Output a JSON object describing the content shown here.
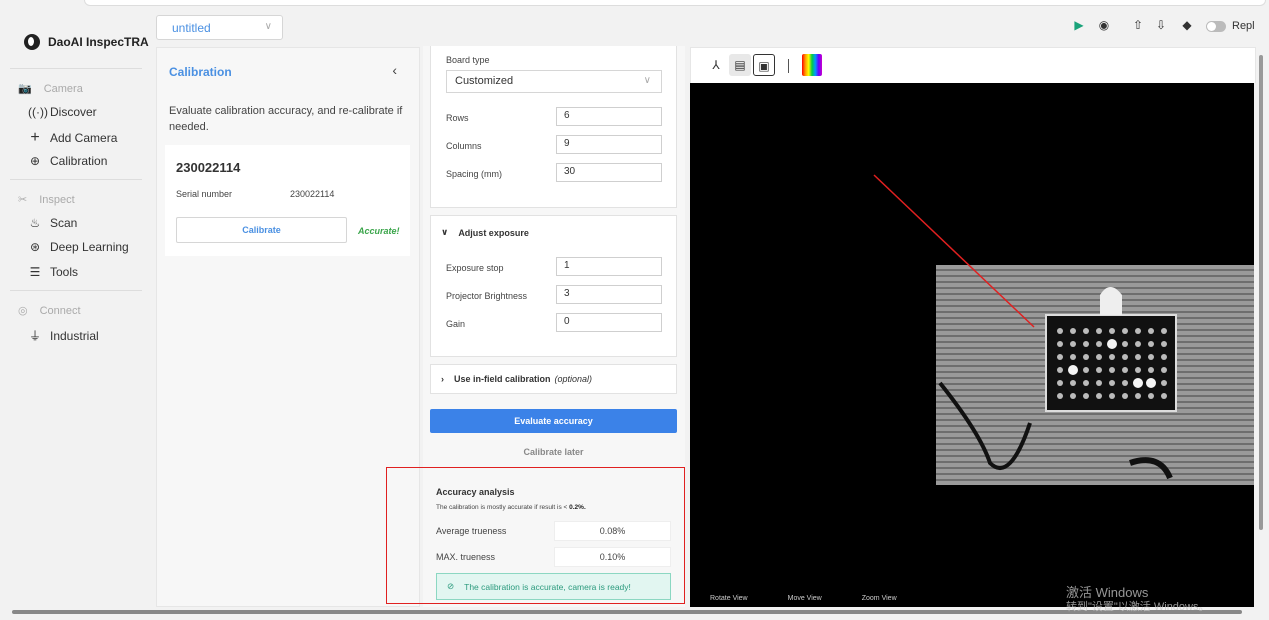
{
  "app": {
    "name": "DaoAI InspecTRA",
    "project": "untitled"
  },
  "sidebar": {
    "sections": [
      {
        "title": "Camera",
        "items": [
          "Discover",
          "Add Camera",
          "Calibration"
        ]
      },
      {
        "title": "Inspect",
        "items": [
          "Scan",
          "Deep Learning",
          "Tools"
        ]
      },
      {
        "title": "Connect",
        "items": [
          "Industrial"
        ]
      }
    ]
  },
  "calibration": {
    "title": "Calibration",
    "description": "Evaluate calibration accuracy, and re-calibrate if needed.",
    "camera_id": "230022114",
    "serial_label": "Serial number",
    "serial_value": "230022114",
    "calibrate_label": "Calibrate",
    "status": "Accurate!"
  },
  "settings": {
    "board_type_label": "Board type",
    "board_type_value": "Customized",
    "rows_label": "Rows",
    "rows_value": "6",
    "columns_label": "Columns",
    "columns_value": "9",
    "spacing_label": "Spacing (mm)",
    "spacing_value": "30",
    "exposure_header": "Adjust exposure",
    "exposure_stop_label": "Exposure stop",
    "exposure_stop_value": "1",
    "projector_label": "Projector Brightness",
    "projector_value": "3",
    "gain_label": "Gain",
    "gain_value": "0",
    "infield_header": "Use in-field calibration",
    "infield_optional": "(optional)",
    "evaluate_label": "Evaluate accuracy",
    "calibrate_later_label": "Calibrate later"
  },
  "accuracy": {
    "title": "Accuracy analysis",
    "note": "The calibration is mostly accurate if result is <",
    "note_threshold": "0.2%.",
    "avg_label": "Average trueness",
    "avg_value": "0.08%",
    "max_label": "MAX. trueness",
    "max_value": "0.10%",
    "ready_message": "The calibration is accurate, camera is ready!"
  },
  "viewer": {
    "rotate": "Rotate View",
    "move": "Move View",
    "zoom": "Zoom View"
  },
  "header": {
    "replay": "Repl"
  },
  "watermark": {
    "line1": "激活 Windows",
    "line2": "转到\"设置\"以激活 Windows。"
  },
  "colors": {
    "accent": "#3b82e8",
    "success": "#3aa54a",
    "highlight": "#e02020"
  }
}
